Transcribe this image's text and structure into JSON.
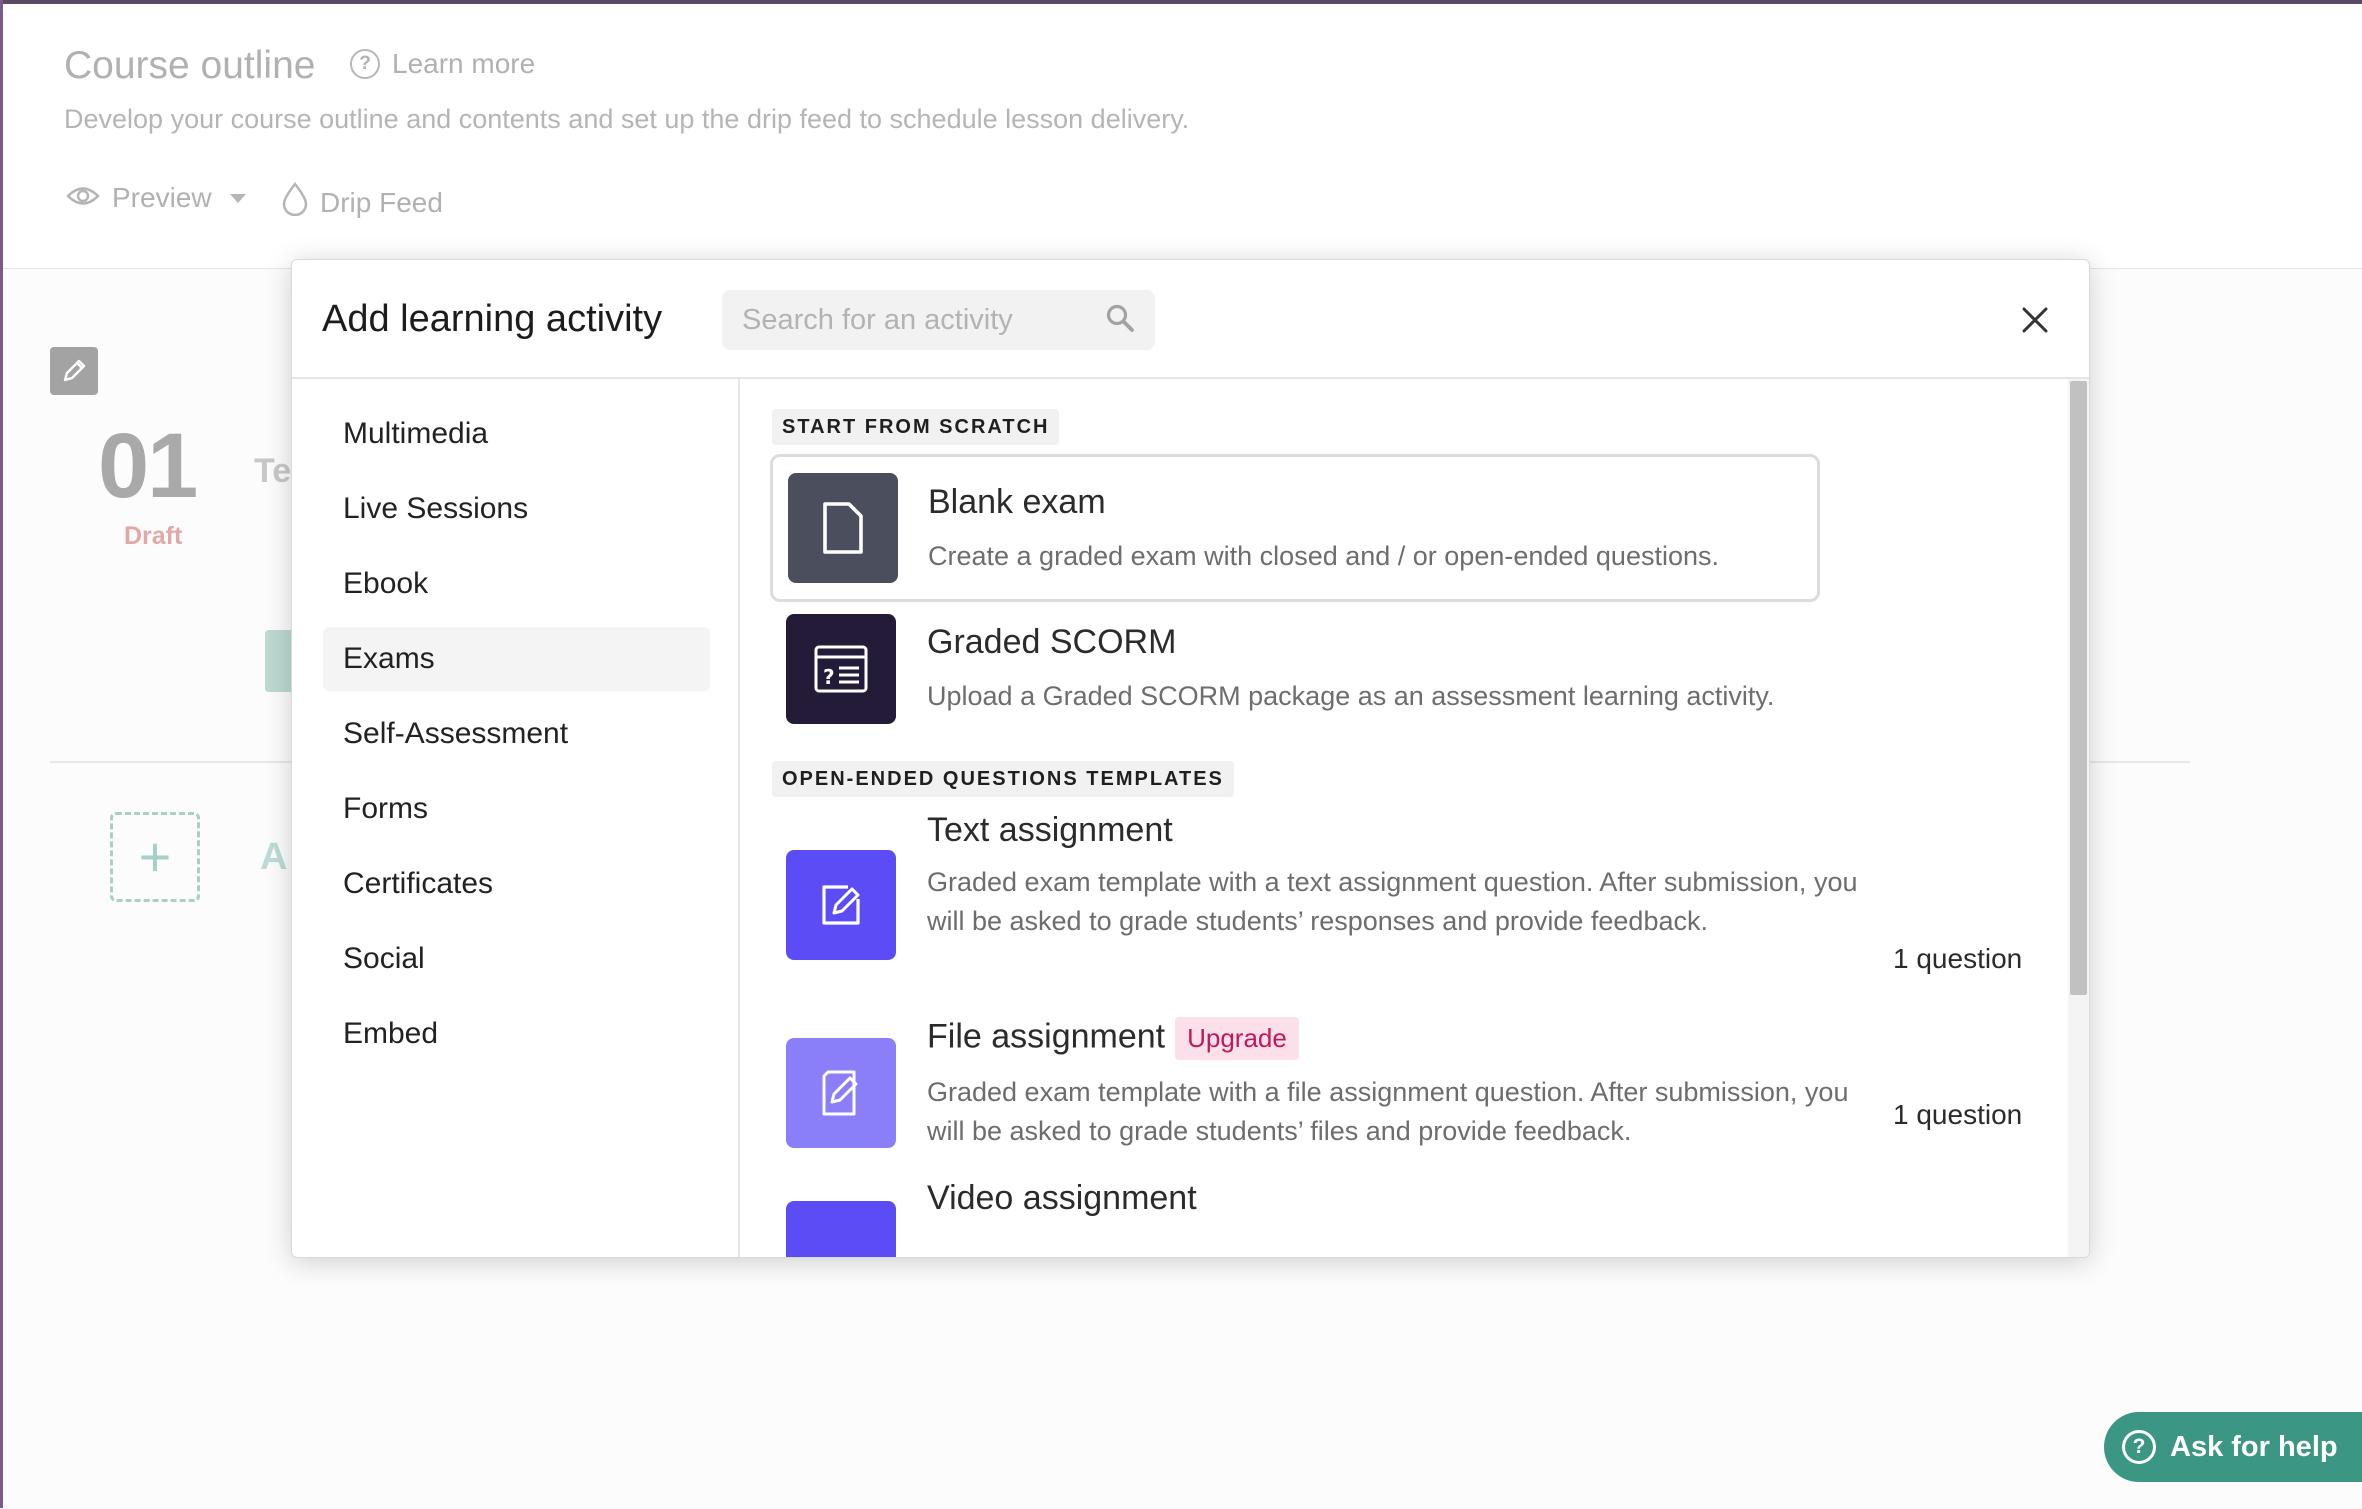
{
  "page": {
    "title": "Course outline",
    "learn_more": "Learn more",
    "subtitle": "Develop your course outline and contents and set up the drip feed to schedule lesson delivery.",
    "preview_label": "Preview",
    "drip_feed_label": "Drip Feed",
    "lesson_number": "01",
    "lesson_status": "Draft",
    "lesson_title_partial": "Te",
    "add_partial": "A"
  },
  "help": {
    "label": "Ask for help"
  },
  "modal": {
    "title": "Add learning activity",
    "search_placeholder": "Search for an activity",
    "categories": [
      {
        "label": "Multimedia"
      },
      {
        "label": "Live Sessions"
      },
      {
        "label": "Ebook"
      },
      {
        "label": "Exams",
        "active": true
      },
      {
        "label": "Self-Assessment"
      },
      {
        "label": "Forms"
      },
      {
        "label": "Certificates"
      },
      {
        "label": "Social"
      },
      {
        "label": "Embed"
      }
    ],
    "sections": [
      {
        "label": "START FROM SCRATCH"
      },
      {
        "label": "OPEN-ENDED QUESTIONS TEMPLATES"
      }
    ],
    "activities": [
      {
        "title": "Blank exam",
        "description": "Create a graded exam with closed and / or open-ended questions.",
        "icon": "document-icon",
        "icon_color": "#4b4e5c"
      },
      {
        "title": "Graded SCORM",
        "description": "Upload a Graded SCORM package as an assessment learning activity.",
        "icon": "scorm-icon",
        "icon_color": "#231b38"
      },
      {
        "title": "Text assignment",
        "description": "Graded exam template with a text assignment question. After submission, you will be asked to grade students’ responses and provide feedback.",
        "count": "1 question",
        "icon": "edit-icon",
        "icon_color": "#5b4cf5"
      },
      {
        "title": "File assignment",
        "badge": "Upgrade",
        "description": "Graded exam template with a file assignment question. After submission, you will be asked to grade students’ files and provide feedback.",
        "count": "1 question",
        "icon": "file-edit-icon",
        "icon_color": "#8b7ef9"
      },
      {
        "title": "Video assignment",
        "icon": "video-icon",
        "icon_color": "#5b4cf5"
      }
    ]
  },
  "colors": {
    "help_button": "#3b9783",
    "upgrade_badge_bg": "#fbe0ea",
    "upgrade_badge_text": "#c0185b",
    "draft_text": "#e2a8a8"
  }
}
